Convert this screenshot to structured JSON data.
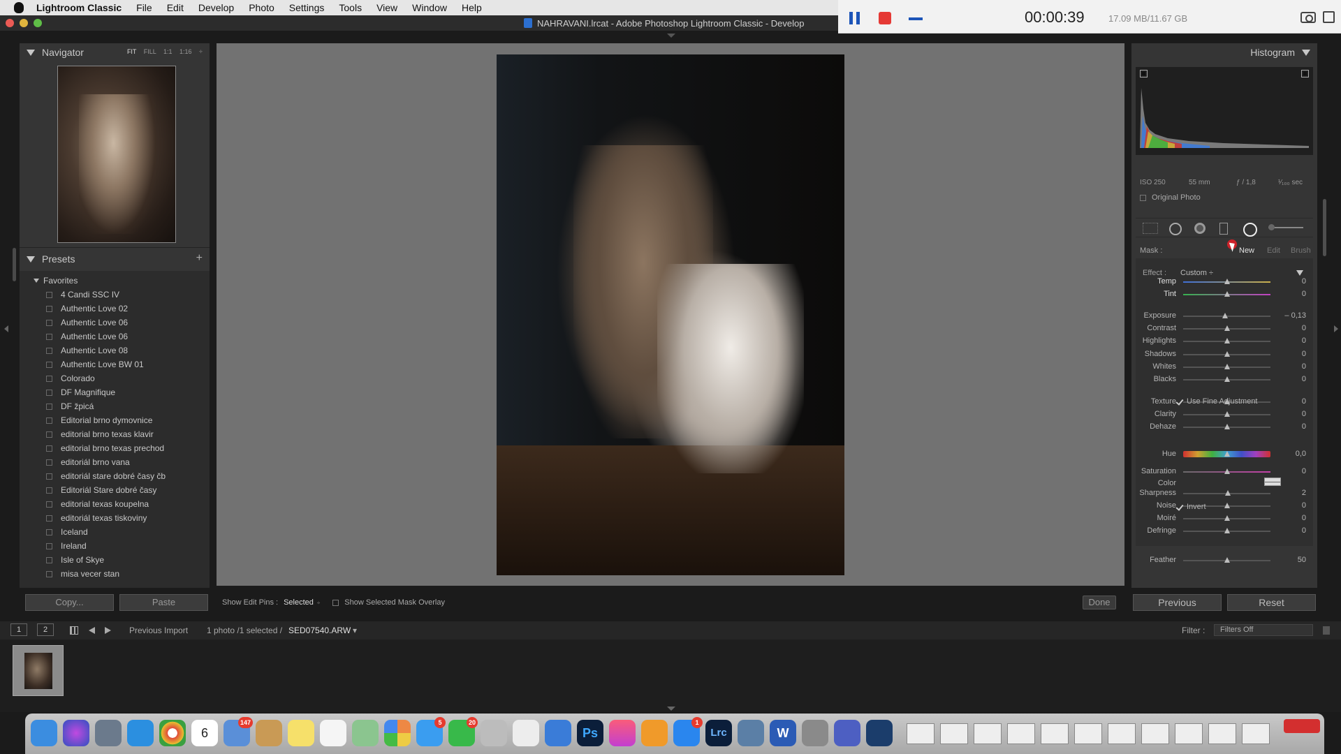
{
  "menubar": {
    "app_name": "Lightroom Classic",
    "items": [
      "File",
      "Edit",
      "Develop",
      "Photo",
      "Settings",
      "Tools",
      "View",
      "Window",
      "Help"
    ]
  },
  "recorder": {
    "time": "00:00:39",
    "size": "17.09 MB/11.67 GB"
  },
  "window": {
    "title": "NAHRAVANI.lrcat - Adobe Photoshop Lightroom Classic - Develop"
  },
  "navigator": {
    "title": "Navigator",
    "zoom_fit": "FIT",
    "zoom_fill": "FILL",
    "zoom_1_1": "1:1",
    "zoom_1_16": "1:16 ÷"
  },
  "presets": {
    "title": "Presets",
    "add": "+",
    "group": "Favorites",
    "items": [
      "4 Candi SSC IV",
      "Authentic Love 02",
      "Authentic Love 06",
      "Authentic Love 06",
      "Authentic Love 08",
      "Authentic Love BW 01",
      "Colorado",
      "DF Magnifique",
      "DF žpicá",
      "Editorial brno dymovnice",
      "editorial brno texas klavir",
      "editorial brno texas prechod",
      "editoriál brno vana",
      "editoriál stare dobré časy čb",
      "Editoriál Stare dobré časy",
      "editorial texas koupelna",
      "editoriál texas tiskoviny",
      "Iceland",
      "Ireland",
      "Isle of Skye",
      "misa vecer stan"
    ]
  },
  "left_buttons": {
    "copy": "Copy...",
    "paste": "Paste"
  },
  "toolbar": {
    "edit_pins_label": "Show Edit Pins :",
    "edit_pins_value": "Selected",
    "edit_pins_chevron": "÷",
    "overlay_label": "Show Selected Mask Overlay",
    "done": "Done"
  },
  "histogram": {
    "title": "Histogram",
    "iso": "ISO 250",
    "focal": "55 mm",
    "aperture": "ƒ / 1,8",
    "shutter": "¹⁄₁₀₀ sec",
    "original_photo": "Original Photo"
  },
  "mask": {
    "label": "Mask :",
    "new": "New",
    "edit": "Edit",
    "brush": "Brush"
  },
  "effect": {
    "label": "Effect :",
    "value": "Custom ÷"
  },
  "sliders": [
    {
      "label": "Temp",
      "value": "0",
      "pos": 0.5
    },
    {
      "label": "Tint",
      "value": "0",
      "pos": 0.5
    },
    {
      "label": "Exposure",
      "value": "– 0,13",
      "pos": 0.48
    },
    {
      "label": "Contrast",
      "value": "0",
      "pos": 0.5
    },
    {
      "label": "Highlights",
      "value": "0",
      "pos": 0.5
    },
    {
      "label": "Shadows",
      "value": "0",
      "pos": 0.5
    },
    {
      "label": "Whites",
      "value": "0",
      "pos": 0.5
    },
    {
      "label": "Blacks",
      "value": "0",
      "pos": 0.5
    },
    {
      "label": "Texture",
      "value": "0",
      "pos": 0.5
    },
    {
      "label": "Clarity",
      "value": "0",
      "pos": 0.5
    },
    {
      "label": "Dehaze",
      "value": "0",
      "pos": 0.5
    },
    {
      "label": "Hue",
      "value": "0,0",
      "pos": 0.5
    },
    {
      "label": "Saturation",
      "value": "0",
      "pos": 0.5
    },
    {
      "label": "Sharpness",
      "value": "2",
      "pos": 0.51
    },
    {
      "label": "Noise",
      "value": "0",
      "pos": 0.5
    },
    {
      "label": "Moiré",
      "value": "0",
      "pos": 0.5
    },
    {
      "label": "Defringe",
      "value": "0",
      "pos": 0.5
    },
    {
      "label": "Feather",
      "value": "50",
      "pos": 0.5
    }
  ],
  "fine_adjustment": "Use Fine Adjustment",
  "color_label": "Color",
  "invert_label": "Invert",
  "right_buttons": {
    "previous": "Previous",
    "reset": "Reset"
  },
  "filmbar": {
    "page1": "1",
    "page2": "2",
    "source": "Previous Import",
    "count": "1 photo /1 selected /",
    "filename": "SED07540.ARW",
    "filename_chevron": "▾",
    "filter_label": "Filter :",
    "filter_value": "Filters Off"
  },
  "dock": {
    "calendar_day": "6",
    "mail_badge": "147",
    "messages_badge": "5",
    "facetime_badge": "20",
    "appstore_badge": "1",
    "ps": "Ps",
    "lrc": "Lrc",
    "word": "W"
  }
}
